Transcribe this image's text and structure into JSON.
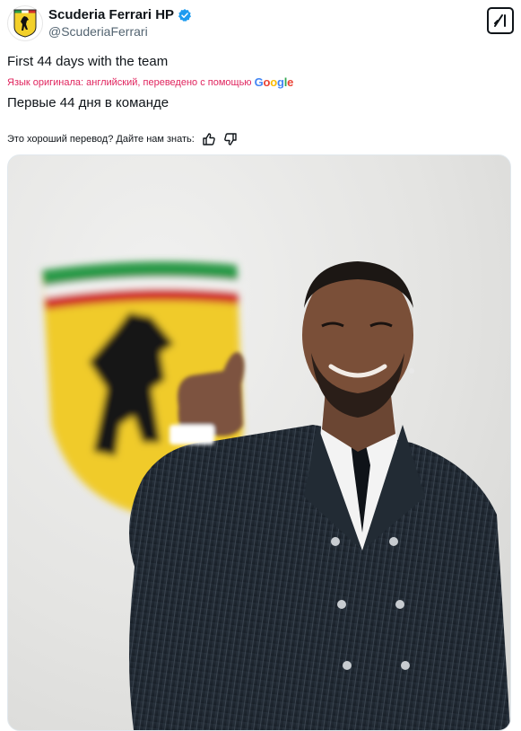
{
  "account": {
    "display_name": "Scuderia Ferrari HP",
    "handle": "@ScuderiaFerrari"
  },
  "tweet": {
    "text": "First 44 days with the team",
    "translation_note": "Язык оригинала: английский, переведено с помощью",
    "translation_provider": [
      "G",
      "o",
      "o",
      "g",
      "l",
      "e"
    ],
    "translated_text": "Первые 44 дня в команде",
    "feedback_prompt": "Это хороший перевод? Дайте нам знать:"
  },
  "icons": {
    "avatar": "ferrari-shield-logo",
    "verified": "verified-badge-icon",
    "grok": "grok-icon",
    "thumbs_up": "thumbs-up-icon",
    "thumbs_down": "thumbs-down-icon"
  },
  "colors": {
    "verified_blue": "#1d9bf0",
    "note_pink": "#e0245e",
    "ferrari_yellow": "#f3d02a",
    "ferrari_red": "#d2302a",
    "ferrari_green": "#2a9b4a"
  }
}
